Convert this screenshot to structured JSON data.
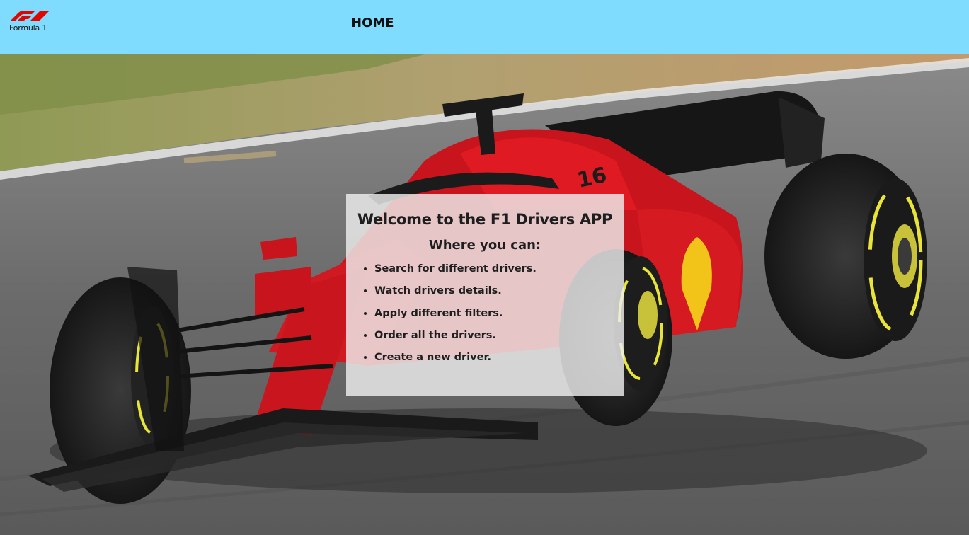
{
  "navbar": {
    "logo_text": "Formula 1",
    "home_label": "HOME",
    "background_color": "#7fdcff",
    "logo_color": "#e10600"
  },
  "hero": {
    "image": "red-f1-car-on-track",
    "welcome": {
      "title": "Welcome to the F1 Drivers APP",
      "subtitle": "Where you can:",
      "items": [
        "Search for different drivers.",
        "Watch drivers details.",
        "Apply different filters.",
        "Order all the drivers.",
        "Create a new driver."
      ]
    }
  }
}
